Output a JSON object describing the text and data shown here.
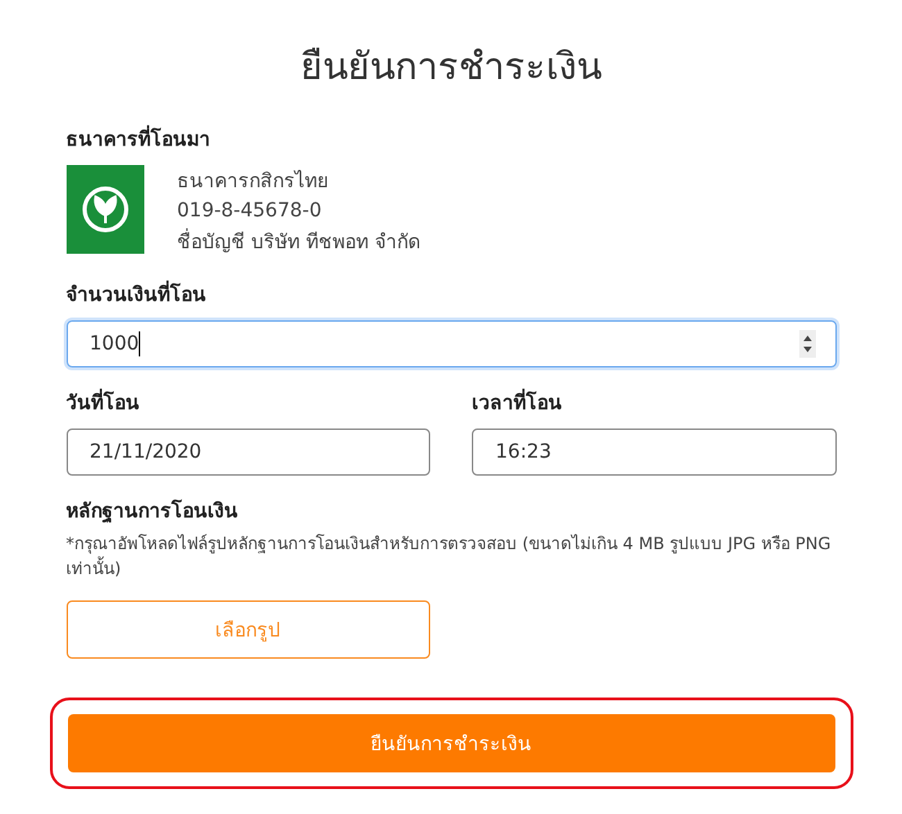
{
  "title": "ยืนยันการชำระเงิน",
  "bank_section": {
    "label": "ธนาคารที่โอนมา",
    "bank_name": "ธนาคารกสิกรไทย",
    "account_number": "019-8-45678-0",
    "account_name": "ชื่อบัญชี บริษัท ทีชพอท จำกัด"
  },
  "amount": {
    "label": "จำนวนเงินที่โอน",
    "value": "1000",
    "focused": true
  },
  "date": {
    "label": "วันที่โอน",
    "value": "21/11/2020"
  },
  "time": {
    "label": "เวลาที่โอน",
    "value": "16:23"
  },
  "evidence": {
    "label": "หลักฐานการโอนเงิน",
    "note": "*กรุณาอัพโหลดไฟล์รูปหลักฐานการโอนเงินสำหรับการตรวจสอบ (ขนาดไม่เกิน 4 MB รูปแบบ JPG หรือ PNG เท่านั้น)",
    "button": "เลือกรูป"
  },
  "submit": {
    "label": "ยืนยันการชำระเงิน",
    "highlighted": true
  }
}
